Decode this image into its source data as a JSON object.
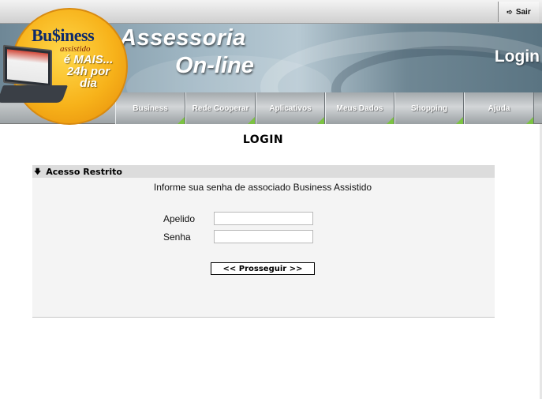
{
  "topbar": {
    "logout_label": "Sair"
  },
  "banner": {
    "title_line1": "Assessoria",
    "title_line2": "On-line",
    "page_name": "Login"
  },
  "logo": {
    "brand": "Bu$iness",
    "sub": "assistido",
    "slogan": "é MAIS... 24h por dia"
  },
  "nav": {
    "items": [
      {
        "label": "Business"
      },
      {
        "label": "Rede Cooperar"
      },
      {
        "label": "Aplicativos"
      },
      {
        "label": "Meus Dados"
      },
      {
        "label": "Shopping"
      },
      {
        "label": "Ajuda"
      }
    ],
    "accent_color": "#7cc243"
  },
  "main": {
    "heading": "LOGIN",
    "panel": {
      "title": "Acesso Restrito",
      "instruction": "Informe sua senha de associado Business Assistido",
      "fields": {
        "nickname_label": "Apelido",
        "nickname_value": "",
        "password_label": "Senha",
        "password_value": ""
      },
      "submit_label": "<< Prosseguir >>"
    }
  }
}
